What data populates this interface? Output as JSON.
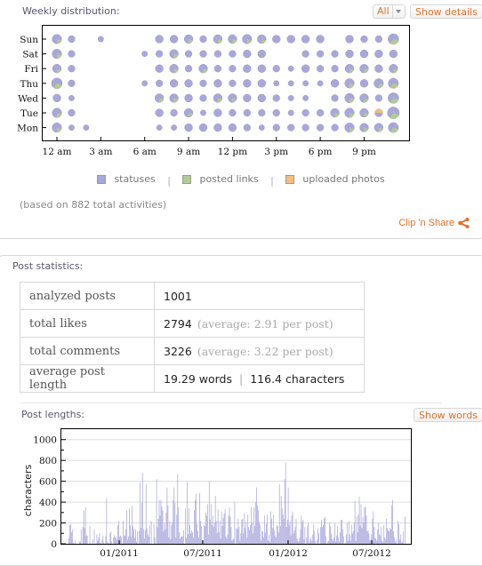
{
  "weekly": {
    "title": "Weekly distribution:",
    "filter_value": "All",
    "show_details_label": "Show details",
    "legend": [
      {
        "label": "statuses",
        "color": "#a8a8d8"
      },
      {
        "label": "posted links",
        "color": "#b0cc90"
      },
      {
        "label": "uploaded photos",
        "color": "#f5bd80"
      }
    ],
    "footnote": "(based on 882 total activities)",
    "clip_share_label": "Clip 'n Share"
  },
  "stats": {
    "title": "Post statistics:",
    "rows": [
      {
        "key": "analyzed posts",
        "value": "1001",
        "extra": ""
      },
      {
        "key": "total likes",
        "value": "2794",
        "extra": "(average: 2.91 per post)"
      },
      {
        "key": "total comments",
        "value": "3226",
        "extra": "(average: 3.22 per post)"
      },
      {
        "key": "average post length",
        "value": "19.29 words",
        "extra": "116.4 characters"
      }
    ]
  },
  "lengths": {
    "title": "Post lengths:",
    "show_words_label": "Show words"
  },
  "chart_data": [
    {
      "type": "scatter",
      "subtype": "bubble-pie",
      "title": "Weekly distribution",
      "days": [
        "Sun",
        "Sat",
        "Fri",
        "Thu",
        "Wed",
        "Tue",
        "Mon"
      ],
      "hours": [
        0,
        1,
        2,
        3,
        4,
        5,
        6,
        7,
        8,
        9,
        10,
        11,
        12,
        13,
        14,
        15,
        16,
        17,
        18,
        19,
        20,
        21,
        22,
        23
      ],
      "x_ticks": [
        "12 am",
        "3 am",
        "6 am",
        "9 am",
        "12 pm",
        "3 pm",
        "6 pm",
        "9 pm"
      ],
      "series": [
        "statuses",
        "posted links",
        "uploaded photos"
      ],
      "counts": {
        "Sun": [
          5,
          2,
          0,
          1,
          0,
          0,
          0,
          3,
          3,
          4,
          2,
          4,
          4,
          5,
          4,
          3,
          3,
          3,
          3,
          0,
          3,
          2,
          2,
          7,
          8
        ],
        "Sat": [
          5,
          2,
          0,
          0,
          0,
          0,
          1,
          2,
          4,
          2,
          2,
          2,
          2,
          3,
          3,
          0,
          0,
          2,
          2,
          2,
          3,
          3,
          3,
          3,
          4
        ],
        "Fri": [
          4,
          2,
          0,
          0,
          0,
          0,
          0,
          3,
          4,
          2,
          4,
          2,
          2,
          3,
          3,
          2,
          1,
          3,
          2,
          2,
          4,
          4,
          3,
          4,
          5
        ],
        "Thu": [
          7,
          2,
          0,
          0,
          0,
          0,
          1,
          2,
          3,
          3,
          2,
          3,
          2,
          3,
          3,
          1,
          1,
          1,
          1,
          3,
          5,
          3,
          5,
          6,
          5
        ],
        "Wed": [
          3,
          1,
          0,
          0,
          0,
          0,
          0,
          4,
          4,
          3,
          2,
          4,
          4,
          3,
          3,
          2,
          1,
          1,
          0,
          2,
          5,
          4,
          2,
          7,
          5
        ],
        "Tue": [
          5,
          2,
          0,
          0,
          0,
          0,
          0,
          3,
          2,
          4,
          1,
          3,
          2,
          2,
          2,
          2,
          1,
          2,
          2,
          4,
          5,
          4,
          3,
          9,
          6
        ],
        "Mon": [
          5,
          1,
          1,
          0,
          0,
          0,
          0,
          1,
          1,
          3,
          3,
          3,
          3,
          2,
          1,
          2,
          2,
          2,
          2,
          2,
          5,
          4,
          4,
          6,
          6
        ]
      },
      "notes": "Bubble area = activity count; most bubbles are mostly statuses with green posted-link wedges; Tue 10 pm bubble contains an uploaded-photos wedge"
    },
    {
      "type": "bar",
      "title": "Post lengths",
      "xlabel": "",
      "ylabel": "characters",
      "ylim": [
        0,
        1100
      ],
      "y_ticks": [
        0,
        200,
        400,
        600,
        800,
        1000
      ],
      "x_ticks": [
        "01/2011",
        "07/2011",
        "01/2012",
        "07/2012"
      ],
      "x_range": [
        "2010-09",
        "2012-10"
      ],
      "color": "#a8a8dc",
      "grid": true,
      "values": [
        60,
        180,
        190,
        110,
        140,
        10,
        0,
        30,
        0,
        0,
        0,
        0,
        20,
        20,
        140,
        0,
        160,
        320,
        150,
        350,
        80,
        80,
        0,
        0,
        170,
        0,
        0,
        40,
        0,
        140,
        0,
        0,
        90,
        30,
        60,
        100,
        10,
        0,
        40,
        80,
        10,
        0,
        70,
        440,
        20,
        10,
        0,
        100,
        120,
        20,
        0,
        60,
        80,
        60,
        70,
        40,
        180,
        220,
        70,
        80,
        60,
        0,
        220,
        80,
        80,
        140,
        320,
        40,
        70,
        340,
        180,
        70,
        360,
        170,
        140,
        60,
        140,
        20,
        120,
        0,
        120,
        590,
        150,
        390,
        680,
        140,
        50,
        130,
        570,
        150,
        90,
        70,
        180,
        0,
        220,
        0,
        0,
        190,
        60,
        0,
        620,
        160,
        240,
        420,
        270,
        420,
        360,
        320,
        120,
        200,
        140,
        300,
        540,
        370,
        60,
        220,
        40,
        180,
        210,
        420,
        540,
        390,
        60,
        280,
        670,
        350,
        110,
        50,
        70,
        70,
        70,
        130,
        0,
        340,
        60,
        590,
        90,
        340,
        180,
        100,
        130,
        110,
        60,
        320,
        420,
        480,
        190,
        120,
        60,
        490,
        220,
        170,
        40,
        30,
        180,
        170,
        300,
        270,
        380,
        90,
        600,
        230,
        380,
        180,
        270,
        160,
        200,
        460,
        220,
        100,
        330,
        110,
        220,
        50,
        310,
        170,
        250,
        290,
        330,
        70,
        50,
        90,
        270,
        350,
        260,
        160,
        30,
        40,
        50,
        400,
        0,
        150,
        140,
        240,
        160,
        30,
        100,
        230,
        240,
        100,
        290,
        150,
        210,
        60,
        280,
        160,
        130,
        180,
        350,
        200,
        100,
        350,
        170,
        400,
        540,
        370,
        320,
        210,
        180,
        30,
        120,
        120,
        60,
        270,
        110,
        190,
        280,
        30,
        90,
        20,
        310,
        240,
        150,
        280,
        130,
        80,
        60,
        180,
        170,
        110,
        570,
        170,
        460,
        340,
        280,
        240,
        620,
        780,
        160,
        230,
        540,
        180,
        220,
        80,
        270,
        310,
        100,
        130,
        160,
        240,
        50,
        30,
        20,
        60,
        140,
        270,
        210,
        230,
        40,
        160,
        0,
        60,
        170,
        200,
        10,
        40,
        60,
        30,
        90,
        190,
        120,
        30,
        0,
        40,
        150,
        100,
        0,
        160,
        230,
        160,
        180,
        240,
        260,
        70,
        0,
        20,
        30,
        200,
        170,
        100,
        50,
        30,
        60,
        200,
        20,
        80,
        170,
        60,
        20,
        110,
        230,
        230,
        140,
        70,
        0,
        10,
        90,
        200,
        30,
        220,
        90,
        30,
        180,
        100,
        120,
        200,
        410,
        30,
        260,
        110,
        280,
        450,
        170,
        380,
        150,
        260,
        200,
        350,
        360,
        270,
        120,
        130,
        100,
        30,
        40,
        90,
        240,
        310,
        160,
        60,
        50,
        30,
        140,
        200,
        90,
        80,
        160,
        30,
        20,
        180,
        60,
        40,
        240,
        150,
        130,
        120,
        150,
        140,
        370,
        420,
        120,
        60,
        20,
        40,
        0,
        220,
        190,
        40,
        90,
        10,
        20,
        120,
        0,
        260
      ]
    }
  ]
}
